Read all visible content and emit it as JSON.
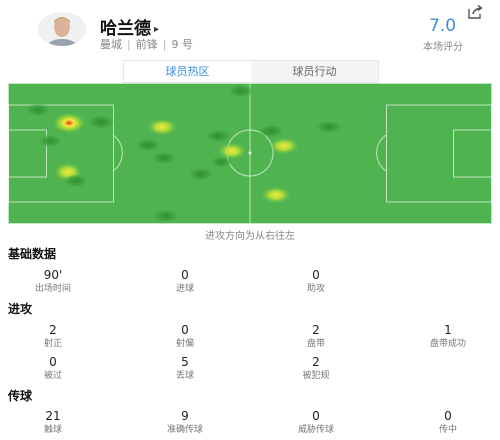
{
  "player": {
    "name": "哈兰德",
    "club": "曼城",
    "position": "前锋",
    "number": "9 号",
    "rating": "7.0",
    "rating_label": "本场评分"
  },
  "tabs": [
    {
      "label": "球员热区",
      "active": true
    },
    {
      "label": "球员行动",
      "active": false
    }
  ],
  "heatmap_note": "进攻方向为从右往左",
  "sections": [
    {
      "title": "基础数据",
      "stats": [
        {
          "value": "90'",
          "label": "出场时间"
        },
        {
          "value": "0",
          "label": "进球"
        },
        {
          "value": "0",
          "label": "助攻"
        }
      ]
    },
    {
      "title": "进攻",
      "stats": [
        {
          "value": "2",
          "label": "射正"
        },
        {
          "value": "0",
          "label": "射偏"
        },
        {
          "value": "2",
          "label": "盘带"
        },
        {
          "value": "1",
          "label": "盘带成功"
        },
        {
          "value": "0",
          "label": "被过"
        },
        {
          "value": "5",
          "label": "丢球"
        },
        {
          "value": "2",
          "label": "被犯规"
        }
      ]
    },
    {
      "title": "传球",
      "stats": [
        {
          "value": "21",
          "label": "触球"
        },
        {
          "value": "9",
          "label": "准确传球"
        },
        {
          "value": "0",
          "label": "威胁传球"
        },
        {
          "value": "0",
          "label": "传中"
        }
      ]
    }
  ],
  "colors": {
    "pitch": "#4fb44f",
    "accent": "#3a8ee6",
    "heat_hot": "#e8332a",
    "heat_warm": "#f5e93a"
  }
}
